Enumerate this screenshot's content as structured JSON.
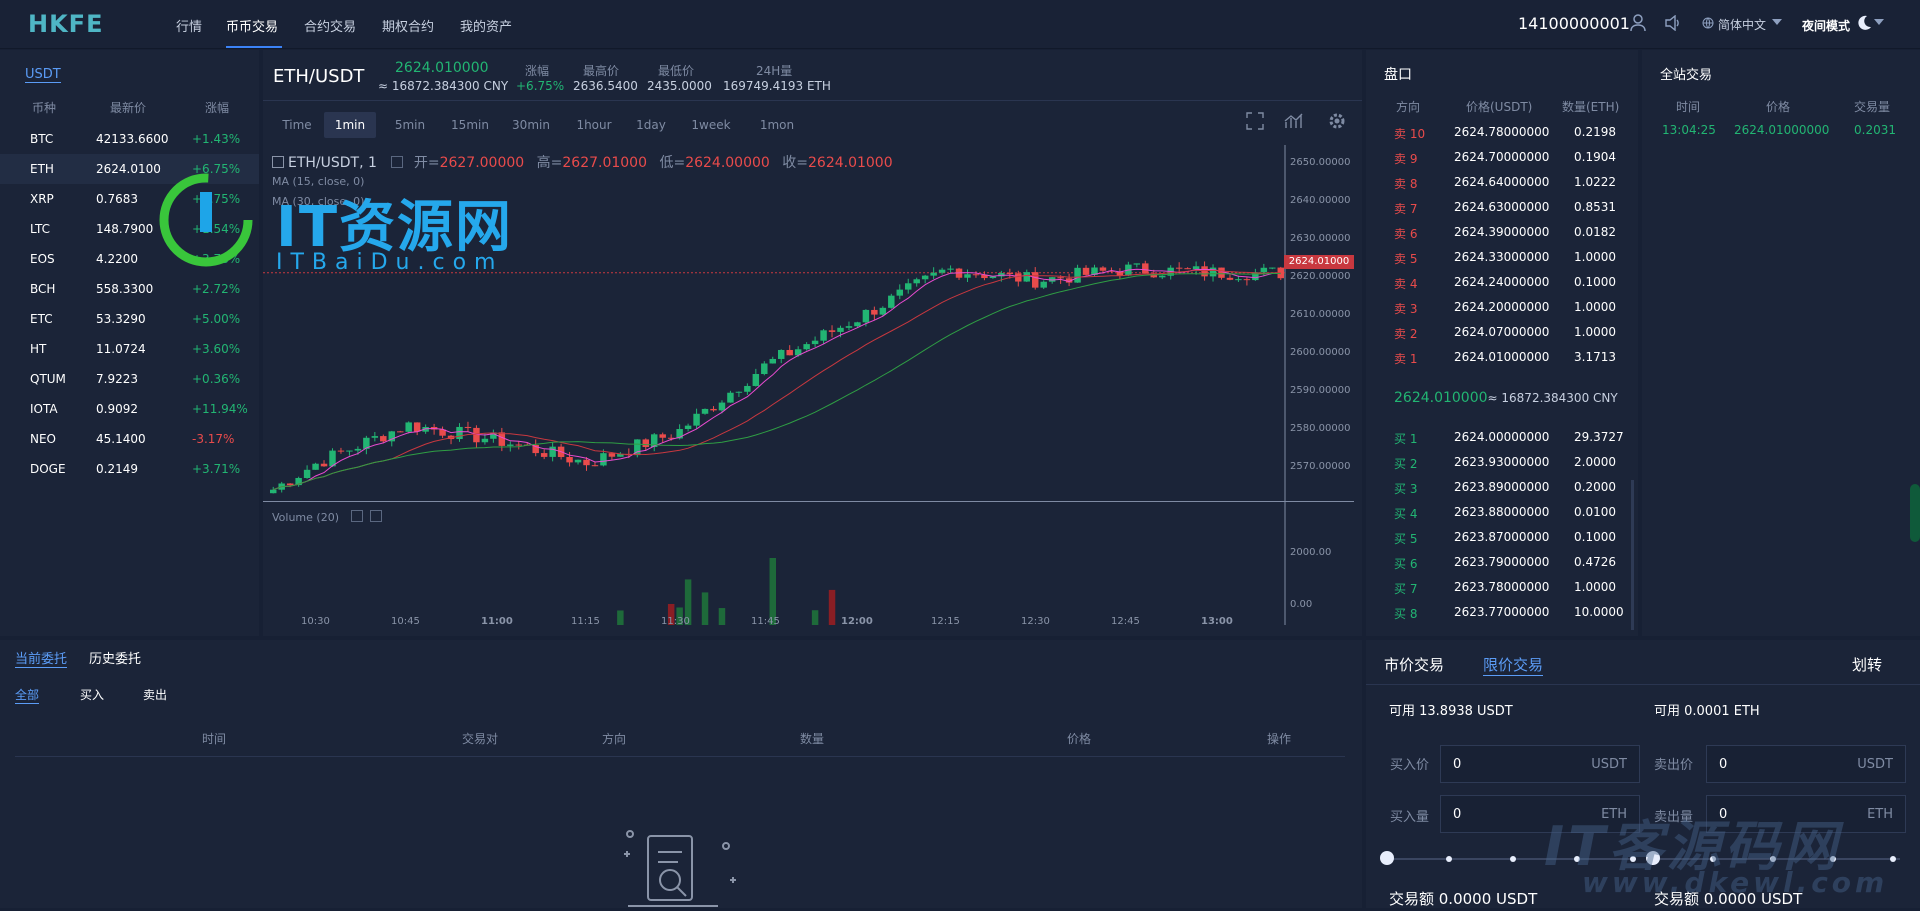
{
  "header": {
    "logo": "HKFE",
    "nav": [
      "行情",
      "币币交易",
      "合约交易",
      "期权合约",
      "我的资产"
    ],
    "account": "14100000001",
    "language": "简体中文",
    "theme": "夜间模式"
  },
  "market": {
    "tab": "USDT",
    "columns": [
      "币种",
      "最新价",
      "涨幅"
    ],
    "rows": [
      {
        "coin": "BTC",
        "price": "42133.6600",
        "change": "+1.43%"
      },
      {
        "coin": "ETH",
        "price": "2624.0100",
        "change": "+6.75%"
      },
      {
        "coin": "XRP",
        "price": "0.7683",
        "change": "+2.75%"
      },
      {
        "coin": "LTC",
        "price": "148.7900",
        "change": "+1.54%"
      },
      {
        "coin": "EOS",
        "price": "4.2200",
        "change": "+3.78%"
      },
      {
        "coin": "BCH",
        "price": "558.3300",
        "change": "+2.72%"
      },
      {
        "coin": "ETC",
        "price": "53.3290",
        "change": "+5.00%"
      },
      {
        "coin": "HT",
        "price": "11.0724",
        "change": "+3.60%"
      },
      {
        "coin": "QTUM",
        "price": "7.9223",
        "change": "+0.36%"
      },
      {
        "coin": "IOTA",
        "price": "0.9092",
        "change": "+11.94%"
      },
      {
        "coin": "NEO",
        "price": "45.1400",
        "change": "-3.17%"
      },
      {
        "coin": "DOGE",
        "price": "0.2149",
        "change": "+3.71%"
      }
    ]
  },
  "ticker": {
    "pair": "ETH/USDT",
    "price": "2624.010000",
    "cny": "≈ 16872.384300 CNY",
    "change_label": "涨幅",
    "change": "+6.75%",
    "high_label": "最高价",
    "high": "2636.5400",
    "low_label": "最低价",
    "low": "2435.0000",
    "vol_label": "24H量",
    "vol": "169749.4193 ETH"
  },
  "chart": {
    "timeframes": [
      "Time",
      "1min",
      "5min",
      "15min",
      "30min",
      "1hour",
      "1day",
      "1week",
      "1mon"
    ],
    "active_tf": "1min",
    "legend_pair": "ETH/USDT, 1",
    "open_label": "开=",
    "open": "2627.00000",
    "high_label": "高=",
    "high": "2627.01000",
    "low_label": "低=",
    "low": "2624.00000",
    "close_label": "收=",
    "close": "2624.01000",
    "ma_label": "MA (15, close, 0)",
    "ma2_label": "MA (30, close, 0)",
    "price_ticks": [
      "2650.00000",
      "2640.00000",
      "2630.00000",
      "2620.00000",
      "2610.00000",
      "2600.00000",
      "2590.00000",
      "2580.00000",
      "2570.00000"
    ],
    "last_price": "2624.01000",
    "volume_label": "Volume (20)",
    "volume_ticks": [
      "2000.00",
      "0.00"
    ],
    "time_ticks": [
      "10:30",
      "10:45",
      "11:00",
      "11:15",
      "11:30",
      "11:45",
      "12:00",
      "12:15",
      "12:30",
      "12:45",
      "13:00"
    ]
  },
  "chart_data": {
    "type": "candlestick",
    "x": [
      "10:30",
      "10:45",
      "11:00",
      "11:15",
      "11:30",
      "11:45",
      "12:00",
      "12:15",
      "12:30",
      "12:45",
      "13:00"
    ],
    "close": [
      2574,
      2584,
      2580,
      2574,
      2582,
      2600,
      2612,
      2625,
      2622,
      2625,
      2624
    ],
    "ylim": [
      2565,
      2655
    ],
    "ylabel": "",
    "xlabel": "",
    "volume_ylim": [
      0,
      2000
    ]
  },
  "orderbook": {
    "title": "盘口",
    "columns": [
      "方向",
      "价格(USDT)",
      "数量(ETH)"
    ],
    "asks": [
      {
        "side": "卖 10",
        "price": "2624.78000000",
        "qty": "0.2198"
      },
      {
        "side": "卖 9",
        "price": "2624.70000000",
        "qty": "0.1904"
      },
      {
        "side": "卖 8",
        "price": "2624.64000000",
        "qty": "1.0222"
      },
      {
        "side": "卖 7",
        "price": "2624.63000000",
        "qty": "0.8531"
      },
      {
        "side": "卖 6",
        "price": "2624.39000000",
        "qty": "0.0182"
      },
      {
        "side": "卖 5",
        "price": "2624.33000000",
        "qty": "1.0000"
      },
      {
        "side": "卖 4",
        "price": "2624.24000000",
        "qty": "0.1000"
      },
      {
        "side": "卖 3",
        "price": "2624.20000000",
        "qty": "1.0000"
      },
      {
        "side": "卖 2",
        "price": "2624.07000000",
        "qty": "1.0000"
      },
      {
        "side": "卖 1",
        "price": "2624.01000000",
        "qty": "3.1713"
      }
    ],
    "mid_price": "2624.010000",
    "mid_cny": "≈ 16872.384300 CNY",
    "bids": [
      {
        "side": "买 1",
        "price": "2624.00000000",
        "qty": "29.3727"
      },
      {
        "side": "买 2",
        "price": "2623.93000000",
        "qty": "2.0000"
      },
      {
        "side": "买 3",
        "price": "2623.89000000",
        "qty": "0.2000"
      },
      {
        "side": "买 4",
        "price": "2623.88000000",
        "qty": "0.0100"
      },
      {
        "side": "买 5",
        "price": "2623.87000000",
        "qty": "0.1000"
      },
      {
        "side": "买 6",
        "price": "2623.79000000",
        "qty": "0.4726"
      },
      {
        "side": "买 7",
        "price": "2623.78000000",
        "qty": "1.0000"
      },
      {
        "side": "买 8",
        "price": "2623.77000000",
        "qty": "10.0000"
      }
    ]
  },
  "trades": {
    "title": "全站交易",
    "columns": [
      "时间",
      "价格",
      "交易量"
    ],
    "rows": [
      {
        "time": "13:04:25",
        "price": "2624.01000000",
        "qty": "0.2031"
      }
    ]
  },
  "orders": {
    "tabs": [
      "当前委托",
      "历史委托"
    ],
    "filters": [
      "全部",
      "买入",
      "卖出"
    ],
    "columns": [
      "时间",
      "交易对",
      "方向",
      "数量",
      "价格",
      "操作"
    ]
  },
  "trade_form": {
    "tabs": [
      "市价交易",
      "限价交易"
    ],
    "transfer": "划转",
    "buy": {
      "available": "可用 13.8938 USDT",
      "price_label": "买入价",
      "price": "0",
      "price_unit": "USDT",
      "amount_label": "买入量",
      "amount": "0",
      "amount_unit": "ETH",
      "total": "交易额 0.0000 USDT"
    },
    "sell": {
      "available": "可用 0.0001 ETH",
      "price_label": "卖出价",
      "price": "0",
      "price_unit": "USDT",
      "amount_label": "卖出量",
      "amount": "0",
      "amount_unit": "ETH",
      "total": "交易额 0.0000 USDT"
    }
  },
  "watermark": {
    "title": "IT资源网",
    "subtitle": "ITBaiDu.com",
    "right": "IT客源码网",
    "right_sub": "www.dkewl.com"
  },
  "colors": {
    "up": "#22b573",
    "down": "#e94b4b",
    "accent": "#3b82f6",
    "bg": "#172034",
    "panel": "#1b2438"
  }
}
